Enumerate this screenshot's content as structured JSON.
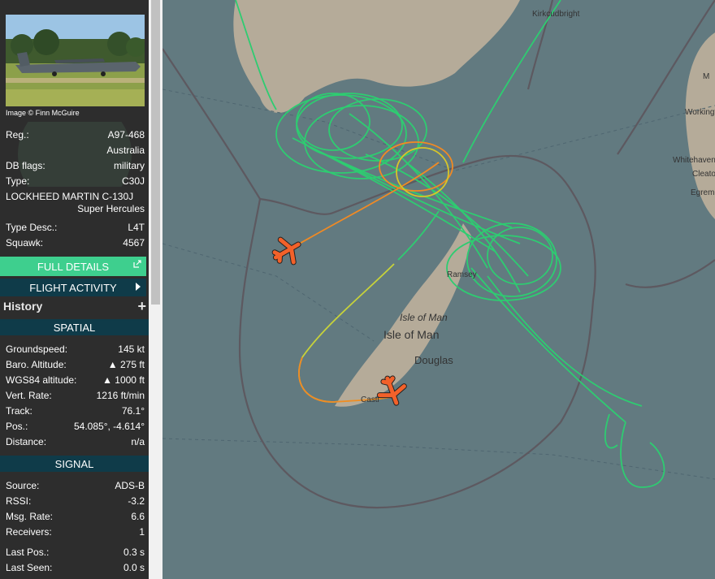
{
  "aircraft": {
    "photo_credit": "Image © Finn McGuire",
    "reg_label": "Reg.:",
    "reg": "A97-468",
    "country": "Australia",
    "db_flags_label": "DB flags:",
    "db_flags": "military",
    "type_label": "Type:",
    "type": "C30J",
    "type_full": "LOCKHEED MARTIN C-130J",
    "type_full2": "Super Hercules",
    "type_desc_label": "Type Desc.:",
    "type_desc": "L4T",
    "squawk_label": "Squawk:",
    "squawk": "4567"
  },
  "buttons": {
    "full_details": "FULL DETAILS",
    "flight_activity": "FLIGHT ACTIVITY",
    "history": "History"
  },
  "spatial": {
    "title": "SPATIAL",
    "rows": [
      {
        "label": "Groundspeed:",
        "value": "145 kt"
      },
      {
        "label": "Baro. Altitude:",
        "value": "▲ 275 ft"
      },
      {
        "label": "WGS84 altitude:",
        "value": "▲ 1000 ft"
      },
      {
        "label": "Vert. Rate:",
        "value": "1216 ft/min"
      },
      {
        "label": "Track:",
        "value": "76.1°"
      },
      {
        "label": "Pos.:",
        "value": "54.085°, -4.614°"
      },
      {
        "label": "Distance:",
        "value": "n/a"
      }
    ]
  },
  "signal": {
    "title": "SIGNAL",
    "rows": [
      {
        "label": "Source:",
        "value": "ADS-B"
      },
      {
        "label": "RSSI:",
        "value": "-3.2"
      },
      {
        "label": "Msg. Rate:",
        "value": "6.6"
      },
      {
        "label": "Receivers:",
        "value": "1"
      },
      {
        "label": "Last Pos.:",
        "value": "0.3 s"
      },
      {
        "label": "Last Seen:",
        "value": "0.0 s"
      }
    ]
  },
  "map": {
    "labels": {
      "kirkcudbright": "Kirkcudbright",
      "workington": "Workingt",
      "whitehaven": "Whitehaven",
      "cleator": "Cleato",
      "egremont": "Egremo",
      "ramsey": "Ramsey",
      "isle_of_man_italic": "Isle of Man",
      "isle_of_man": "Isle of Man",
      "douglas": "Douglas",
      "castletown": "Castl",
      "edge_m": "M"
    },
    "colors": {
      "sea": "#627a80",
      "land": "#b7ad9c",
      "track_green": "#2ecc71",
      "track_orange": "#f08a24",
      "aircraft": "#f2612a"
    }
  }
}
